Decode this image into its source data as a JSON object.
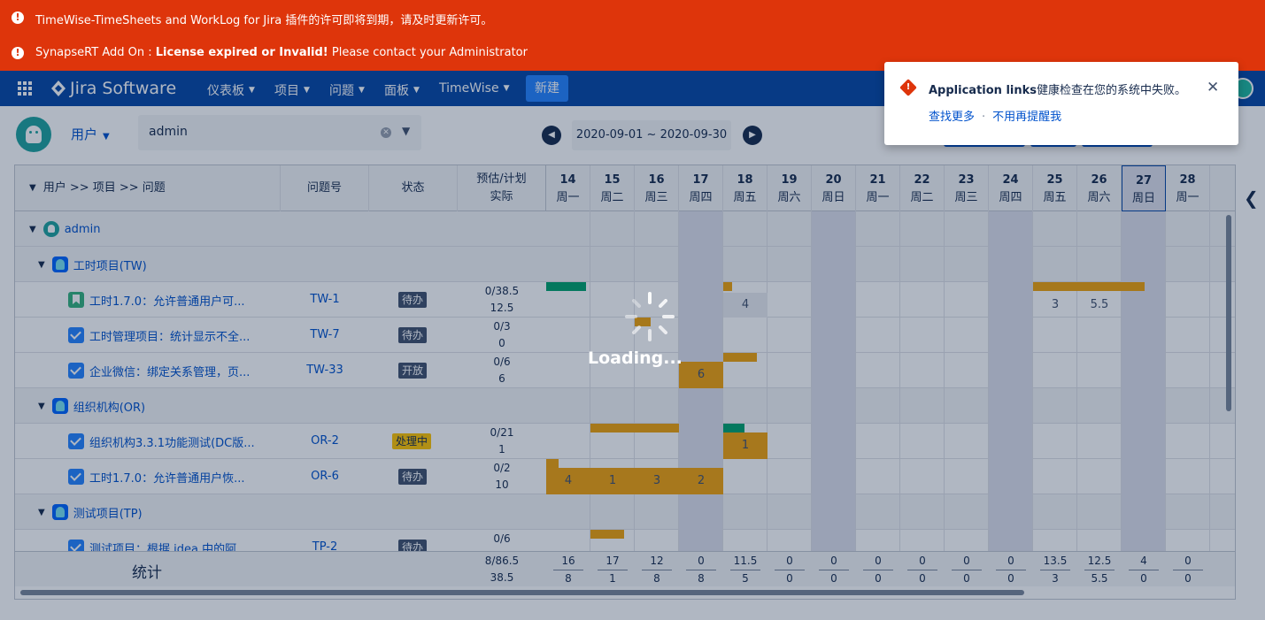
{
  "banners": [
    {
      "text": "TimeWise-TimeSheets and WorkLog for Jira 插件的许可即将到期，请及时更新许可。"
    },
    {
      "prefix": "SynapseRT Add On : ",
      "bold": "License expired or Invalid!",
      "suffix": " Please contact your Administrator"
    }
  ],
  "nav": {
    "logo": "Jira Software",
    "menus": [
      "仪表板",
      "项目",
      "问题",
      "面板",
      "TimeWise"
    ],
    "create": "新建"
  },
  "toolbar": {
    "user_select": "用户",
    "search_value": "admin",
    "date_range": "2020-09-01 ~ 2020-09-30"
  },
  "table": {
    "headers": {
      "tree": "用户 >> 项目 >> 问题",
      "key": "问题号",
      "status": "状态",
      "est1": "预估/计划",
      "est2": "实际"
    },
    "days": [
      {
        "d": "14",
        "w": "周一"
      },
      {
        "d": "15",
        "w": "周二"
      },
      {
        "d": "16",
        "w": "周三"
      },
      {
        "d": "17",
        "w": "周四"
      },
      {
        "d": "18",
        "w": "周五"
      },
      {
        "d": "19",
        "w": "周六"
      },
      {
        "d": "20",
        "w": "周日"
      },
      {
        "d": "21",
        "w": "周一"
      },
      {
        "d": "22",
        "w": "周二"
      },
      {
        "d": "23",
        "w": "周三"
      },
      {
        "d": "24",
        "w": "周四"
      },
      {
        "d": "25",
        "w": "周五"
      },
      {
        "d": "26",
        "w": "周六"
      },
      {
        "d": "27",
        "w": "周日"
      },
      {
        "d": "28",
        "w": "周一"
      }
    ],
    "rows": [
      {
        "type": "user",
        "label": "admin"
      },
      {
        "type": "project",
        "label": "工时项目(TW)"
      },
      {
        "type": "issue",
        "icon": "story",
        "label": "工时1.7.0：允许普通用户可...",
        "key": "TW-1",
        "status": "待办",
        "est": "0/38.5",
        "act": "12.5"
      },
      {
        "type": "issue",
        "icon": "task",
        "label": "工时管理项目：统计显示不全...",
        "key": "TW-7",
        "status": "待办",
        "est": "0/3",
        "act": "0"
      },
      {
        "type": "issue",
        "icon": "task",
        "label": "企业微信：绑定关系管理，页...",
        "key": "TW-33",
        "status": "开放",
        "est": "0/6",
        "act": "6"
      },
      {
        "type": "project",
        "label": "组织机构(OR)"
      },
      {
        "type": "issue",
        "icon": "task",
        "label": "组织机构3.3.1功能测试(DC版...",
        "key": "OR-2",
        "status": "处理中",
        "est": "0/21",
        "act": "1"
      },
      {
        "type": "issue",
        "icon": "task",
        "label": "工时1.7.0：允许普通用户恢...",
        "key": "OR-6",
        "status": "待办",
        "est": "0/2",
        "act": "10"
      },
      {
        "type": "project",
        "label": "测试项目(TP)"
      },
      {
        "type": "issue",
        "icon": "task",
        "label": "测试项目：根据 idea 中的阿...",
        "key": "TP-2",
        "status": "待办",
        "est": "0/6",
        "act": ""
      }
    ],
    "cell_values": [
      {
        "row": 2,
        "day": 4,
        "v": "4"
      },
      {
        "row": 2,
        "day": 11,
        "v": "3"
      },
      {
        "row": 2,
        "day": 12,
        "v": "5.5"
      },
      {
        "row": 4,
        "day": 3,
        "v": "6"
      },
      {
        "row": 6,
        "day": 4,
        "v": "1"
      },
      {
        "row": 7,
        "day": 0,
        "v": "4"
      },
      {
        "row": 7,
        "day": 1,
        "v": "1"
      },
      {
        "row": 7,
        "day": 2,
        "v": "3"
      },
      {
        "row": 7,
        "day": 3,
        "v": "2"
      }
    ],
    "footer": {
      "label": "统计",
      "est": "8/86.5",
      "act": "38.5",
      "days": [
        {
          "t": "16",
          "b": "8"
        },
        {
          "t": "17",
          "b": "1"
        },
        {
          "t": "12",
          "b": "8"
        },
        {
          "t": "0",
          "b": "8"
        },
        {
          "t": "11.5",
          "b": "5"
        },
        {
          "t": "0",
          "b": "0"
        },
        {
          "t": "0",
          "b": "0"
        },
        {
          "t": "0",
          "b": "0"
        },
        {
          "t": "0",
          "b": "0"
        },
        {
          "t": "0",
          "b": "0"
        },
        {
          "t": "0",
          "b": "0"
        },
        {
          "t": "13.5",
          "b": "3"
        },
        {
          "t": "12.5",
          "b": "5.5"
        },
        {
          "t": "4",
          "b": "0"
        },
        {
          "t": "0",
          "b": "0"
        }
      ]
    }
  },
  "loading": "Loading...",
  "toast": {
    "title_bold": "Application links",
    "title_rest": "健康检查在您的系统中失败。",
    "link1": "查找更多",
    "link2": "不用再提醒我"
  },
  "colors": {
    "banner": "#de350b",
    "nav": "#0747a6",
    "primary": "#0052cc",
    "bar_green": "#00a36c",
    "bar_orange": "#f0a30a"
  }
}
